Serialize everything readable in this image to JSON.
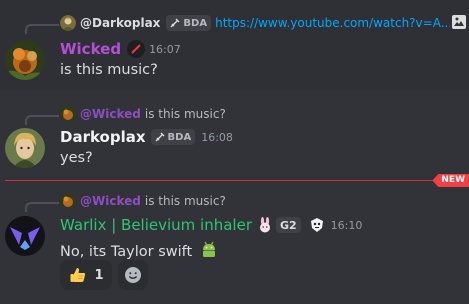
{
  "messages": [
    {
      "reply": {
        "author": "@Darkoplax",
        "tag": "BDA",
        "text": "https://www.youtube.com/watch?v=A..."
      },
      "author": "Wicked",
      "time": "16:07",
      "content": "is this music?",
      "author_color": "#b64fd6"
    },
    {
      "reply": {
        "author": "@Wicked",
        "text": "is this music?"
      },
      "author": "Darkoplax",
      "tag": "BDA",
      "time": "16:08",
      "content": "yes?",
      "author_color": "#f2f3f5"
    },
    {
      "reply": {
        "author": "@Wicked",
        "text": "is this music?"
      },
      "author": "Warlix | Believium inhaler",
      "tag": "G2",
      "time": "16:10",
      "content": "No, its Taylor swift",
      "author_color": "#2dc770",
      "reactions": [
        {
          "icon": "thumbs-up-icon",
          "count": "1"
        }
      ]
    }
  ],
  "divider": {
    "label": "NEW"
  },
  "colors": {
    "background": "#313338",
    "highlight": "#2e3035",
    "wicked": "#9b59b6",
    "warlix": "#2dc770",
    "link": "#00a8fc",
    "new": "#f23f43"
  }
}
